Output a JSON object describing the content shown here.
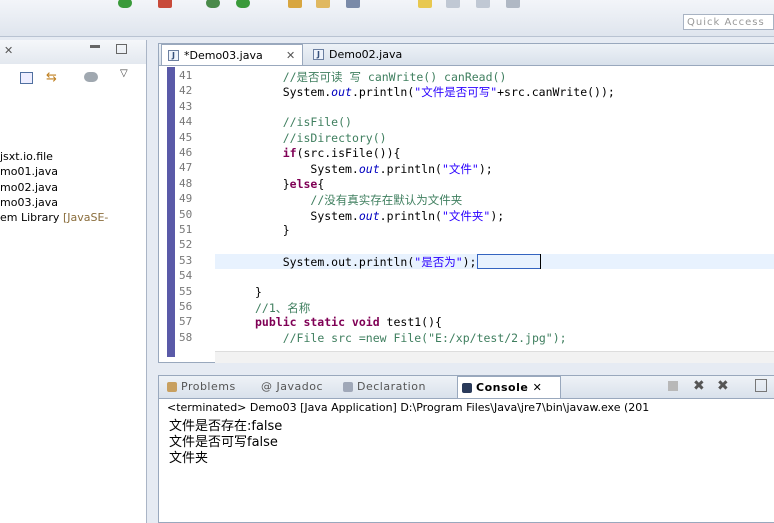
{
  "toolbar": {
    "quick_access_placeholder": "Quick Access"
  },
  "explorer": {
    "items": [
      {
        "label": "jsxt.io.file",
        "suffix": ""
      },
      {
        "label": "mo01.java",
        "suffix": ""
      },
      {
        "label": "mo02.java",
        "suffix": ""
      },
      {
        "label": "mo03.java",
        "suffix": ""
      },
      {
        "label": "em Library ",
        "suffix": "[JavaSE-"
      }
    ]
  },
  "editor": {
    "tabs": [
      {
        "label": "*Demo03.java",
        "close": "✕"
      },
      {
        "label": "Demo02.java"
      }
    ],
    "lines": [
      {
        "n": "41",
        "indent": "    ",
        "parts": [
          [
            "cm",
            "//是否可读 写 canWrite() canRead()"
          ]
        ]
      },
      {
        "n": "42",
        "indent": "    ",
        "parts": [
          [
            "",
            "System."
          ],
          [
            "fd",
            "out"
          ],
          [
            "",
            ".println("
          ],
          [
            "st",
            "\"文件是否可写\""
          ],
          [
            "",
            "+src.canWrite());"
          ]
        ]
      },
      {
        "n": "43",
        "indent": "",
        "parts": []
      },
      {
        "n": "44",
        "indent": "    ",
        "parts": [
          [
            "cm",
            "//isFile()"
          ]
        ]
      },
      {
        "n": "45",
        "indent": "    ",
        "parts": [
          [
            "cm",
            "//isDirectory()"
          ]
        ]
      },
      {
        "n": "46",
        "indent": "    ",
        "parts": [
          [
            "kw",
            "if"
          ],
          [
            "",
            "(src.isFile()){"
          ]
        ]
      },
      {
        "n": "47",
        "indent": "        ",
        "parts": [
          [
            "",
            "System."
          ],
          [
            "fd",
            "out"
          ],
          [
            "",
            ".println("
          ],
          [
            "st",
            "\"文件\""
          ],
          [
            "",
            ");"
          ]
        ]
      },
      {
        "n": "48",
        "indent": "    ",
        "parts": [
          [
            "",
            "}"
          ],
          [
            "kw",
            "else"
          ],
          [
            "",
            "{"
          ]
        ]
      },
      {
        "n": "49",
        "indent": "        ",
        "parts": [
          [
            "cm",
            "//没有真实存在默认为文件夹"
          ]
        ]
      },
      {
        "n": "50",
        "indent": "        ",
        "parts": [
          [
            "",
            "System."
          ],
          [
            "fd",
            "out"
          ],
          [
            "",
            ".println("
          ],
          [
            "st",
            "\"文件夹\""
          ],
          [
            "",
            ");"
          ]
        ]
      },
      {
        "n": "51",
        "indent": "    ",
        "parts": [
          [
            "",
            "}"
          ]
        ]
      },
      {
        "n": "52",
        "indent": "",
        "parts": []
      },
      {
        "n": "53",
        "indent": "    ",
        "parts": [
          [
            "",
            "System.out.println("
          ],
          [
            "st",
            "\"是否为\""
          ],
          [
            "",
            ");"
          ]
        ]
      },
      {
        "n": "54",
        "indent": "",
        "parts": []
      },
      {
        "n": "55",
        "indent": "",
        "parts": [
          [
            "",
            "}"
          ]
        ]
      },
      {
        "n": "56",
        "indent": "",
        "parts": [
          [
            "cm",
            "//1、名称"
          ]
        ]
      },
      {
        "n": "57",
        "indent": "",
        "parts": [
          [
            "kw",
            "public static void"
          ],
          [
            "",
            " test1(){"
          ]
        ]
      },
      {
        "n": "58",
        "indent": "    ",
        "parts": [
          [
            "cm",
            "//File src =new File(\"E:/xp/test/2.jpg\");"
          ]
        ]
      }
    ]
  },
  "console": {
    "tabs": [
      {
        "label": "Problems"
      },
      {
        "label": "@ Javadoc"
      },
      {
        "label": "Declaration"
      },
      {
        "label": "Console ✕"
      }
    ],
    "status": "<terminated> Demo03 [Java Application] D:\\Program Files\\Java\\jre7\\bin\\javaw.exe (201",
    "output": [
      "文件是否存在:false",
      "文件是否可写false",
      "文件夹"
    ]
  }
}
